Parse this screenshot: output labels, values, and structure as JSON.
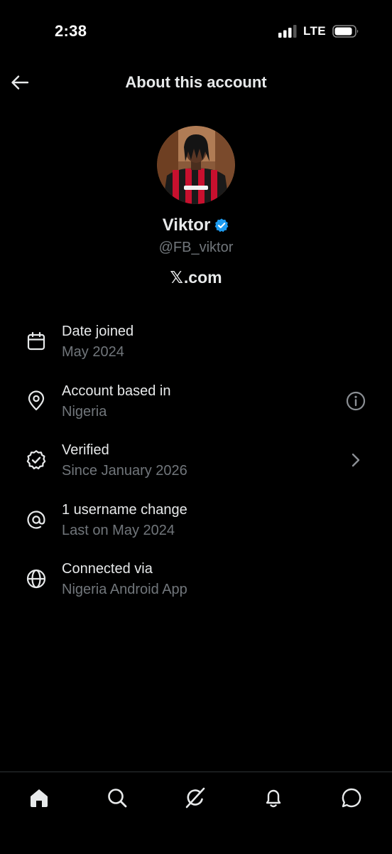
{
  "status_bar": {
    "time": "2:38",
    "network": "LTE",
    "icons": [
      "signal-icon",
      "battery-icon"
    ]
  },
  "header": {
    "title": "About this account",
    "back_icon": "back-arrow-icon"
  },
  "profile": {
    "display_name": "Viktor",
    "handle": "@FB_viktor",
    "verified_badge_color": "#1d9bf0",
    "site_logo": "𝕏",
    "site_domain": ".com"
  },
  "info_rows": [
    {
      "icon": "calendar-icon",
      "title": "Date joined",
      "subtitle": "May 2024",
      "trailing": ""
    },
    {
      "icon": "location-pin-icon",
      "title": "Account based in",
      "subtitle": "Nigeria",
      "trailing": "info-icon"
    },
    {
      "icon": "verified-seal-icon",
      "title": "Verified",
      "subtitle": "Since January 2026",
      "trailing": "chevron-right-icon"
    },
    {
      "icon": "at-sign-icon",
      "title": "1 username change",
      "subtitle": "Last on May 2024",
      "trailing": ""
    },
    {
      "icon": "globe-icon",
      "title": "Connected via",
      "subtitle": "Nigeria Android App",
      "trailing": ""
    }
  ],
  "bottom_nav": {
    "items": [
      "home-icon",
      "search-icon",
      "grok-icon",
      "notifications-icon",
      "messages-icon"
    ]
  },
  "colors": {
    "background": "#000000",
    "primary_text": "#e7e9ea",
    "secondary_text": "#71767b",
    "accent": "#1d9bf0",
    "divider": "#2f3336"
  }
}
